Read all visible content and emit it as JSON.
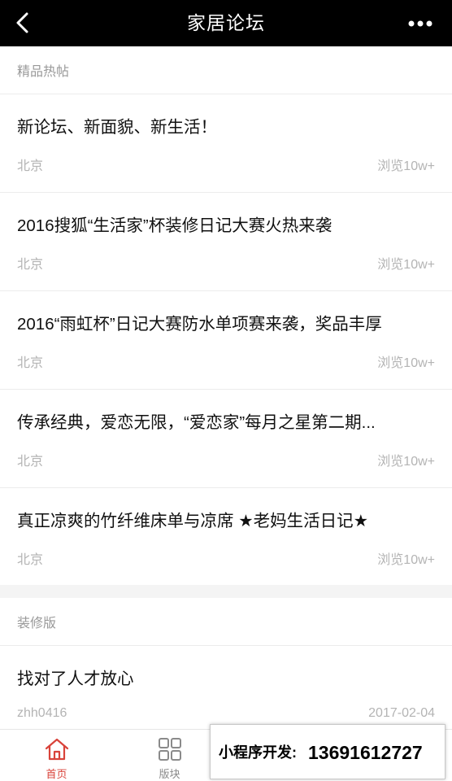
{
  "header": {
    "title": "家居论坛"
  },
  "sections": [
    {
      "title": "精品热帖",
      "posts": [
        {
          "title": "新论坛、新面貌、新生活！",
          "location": "北京",
          "views": "浏览10w+"
        },
        {
          "title": "2016搜狐“生活家”杯装修日记大赛火热来袭",
          "location": "北京",
          "views": "浏览10w+"
        },
        {
          "title": "2016“雨虹杯”日记大赛防水单项赛来袭，奖品丰厚",
          "location": "北京",
          "views": "浏览10w+"
        },
        {
          "title": "传承经典，爱恋无限，“爱恋家”每月之星第二期...",
          "location": "北京",
          "views": "浏览10w+"
        },
        {
          "title": "真正凉爽的竹纤维床单与凉席 ★老妈生活日记★",
          "location": "北京",
          "views": "浏览10w+"
        }
      ]
    },
    {
      "title": "装修版",
      "posts": [
        {
          "title": "找对了人才放心",
          "location": "zhh0416",
          "views": "2017-02-04"
        }
      ]
    }
  ],
  "tabbar": {
    "tabs": [
      {
        "label": "首页",
        "icon": "home-icon",
        "active": true
      },
      {
        "label": "版块",
        "icon": "grid-icon",
        "active": false
      }
    ]
  },
  "promo": {
    "label": "小程序开发:",
    "phone": "13691612727"
  },
  "colors": {
    "accent": "#d9433a",
    "header_bg": "#000000",
    "muted": "#b4b4b4"
  }
}
